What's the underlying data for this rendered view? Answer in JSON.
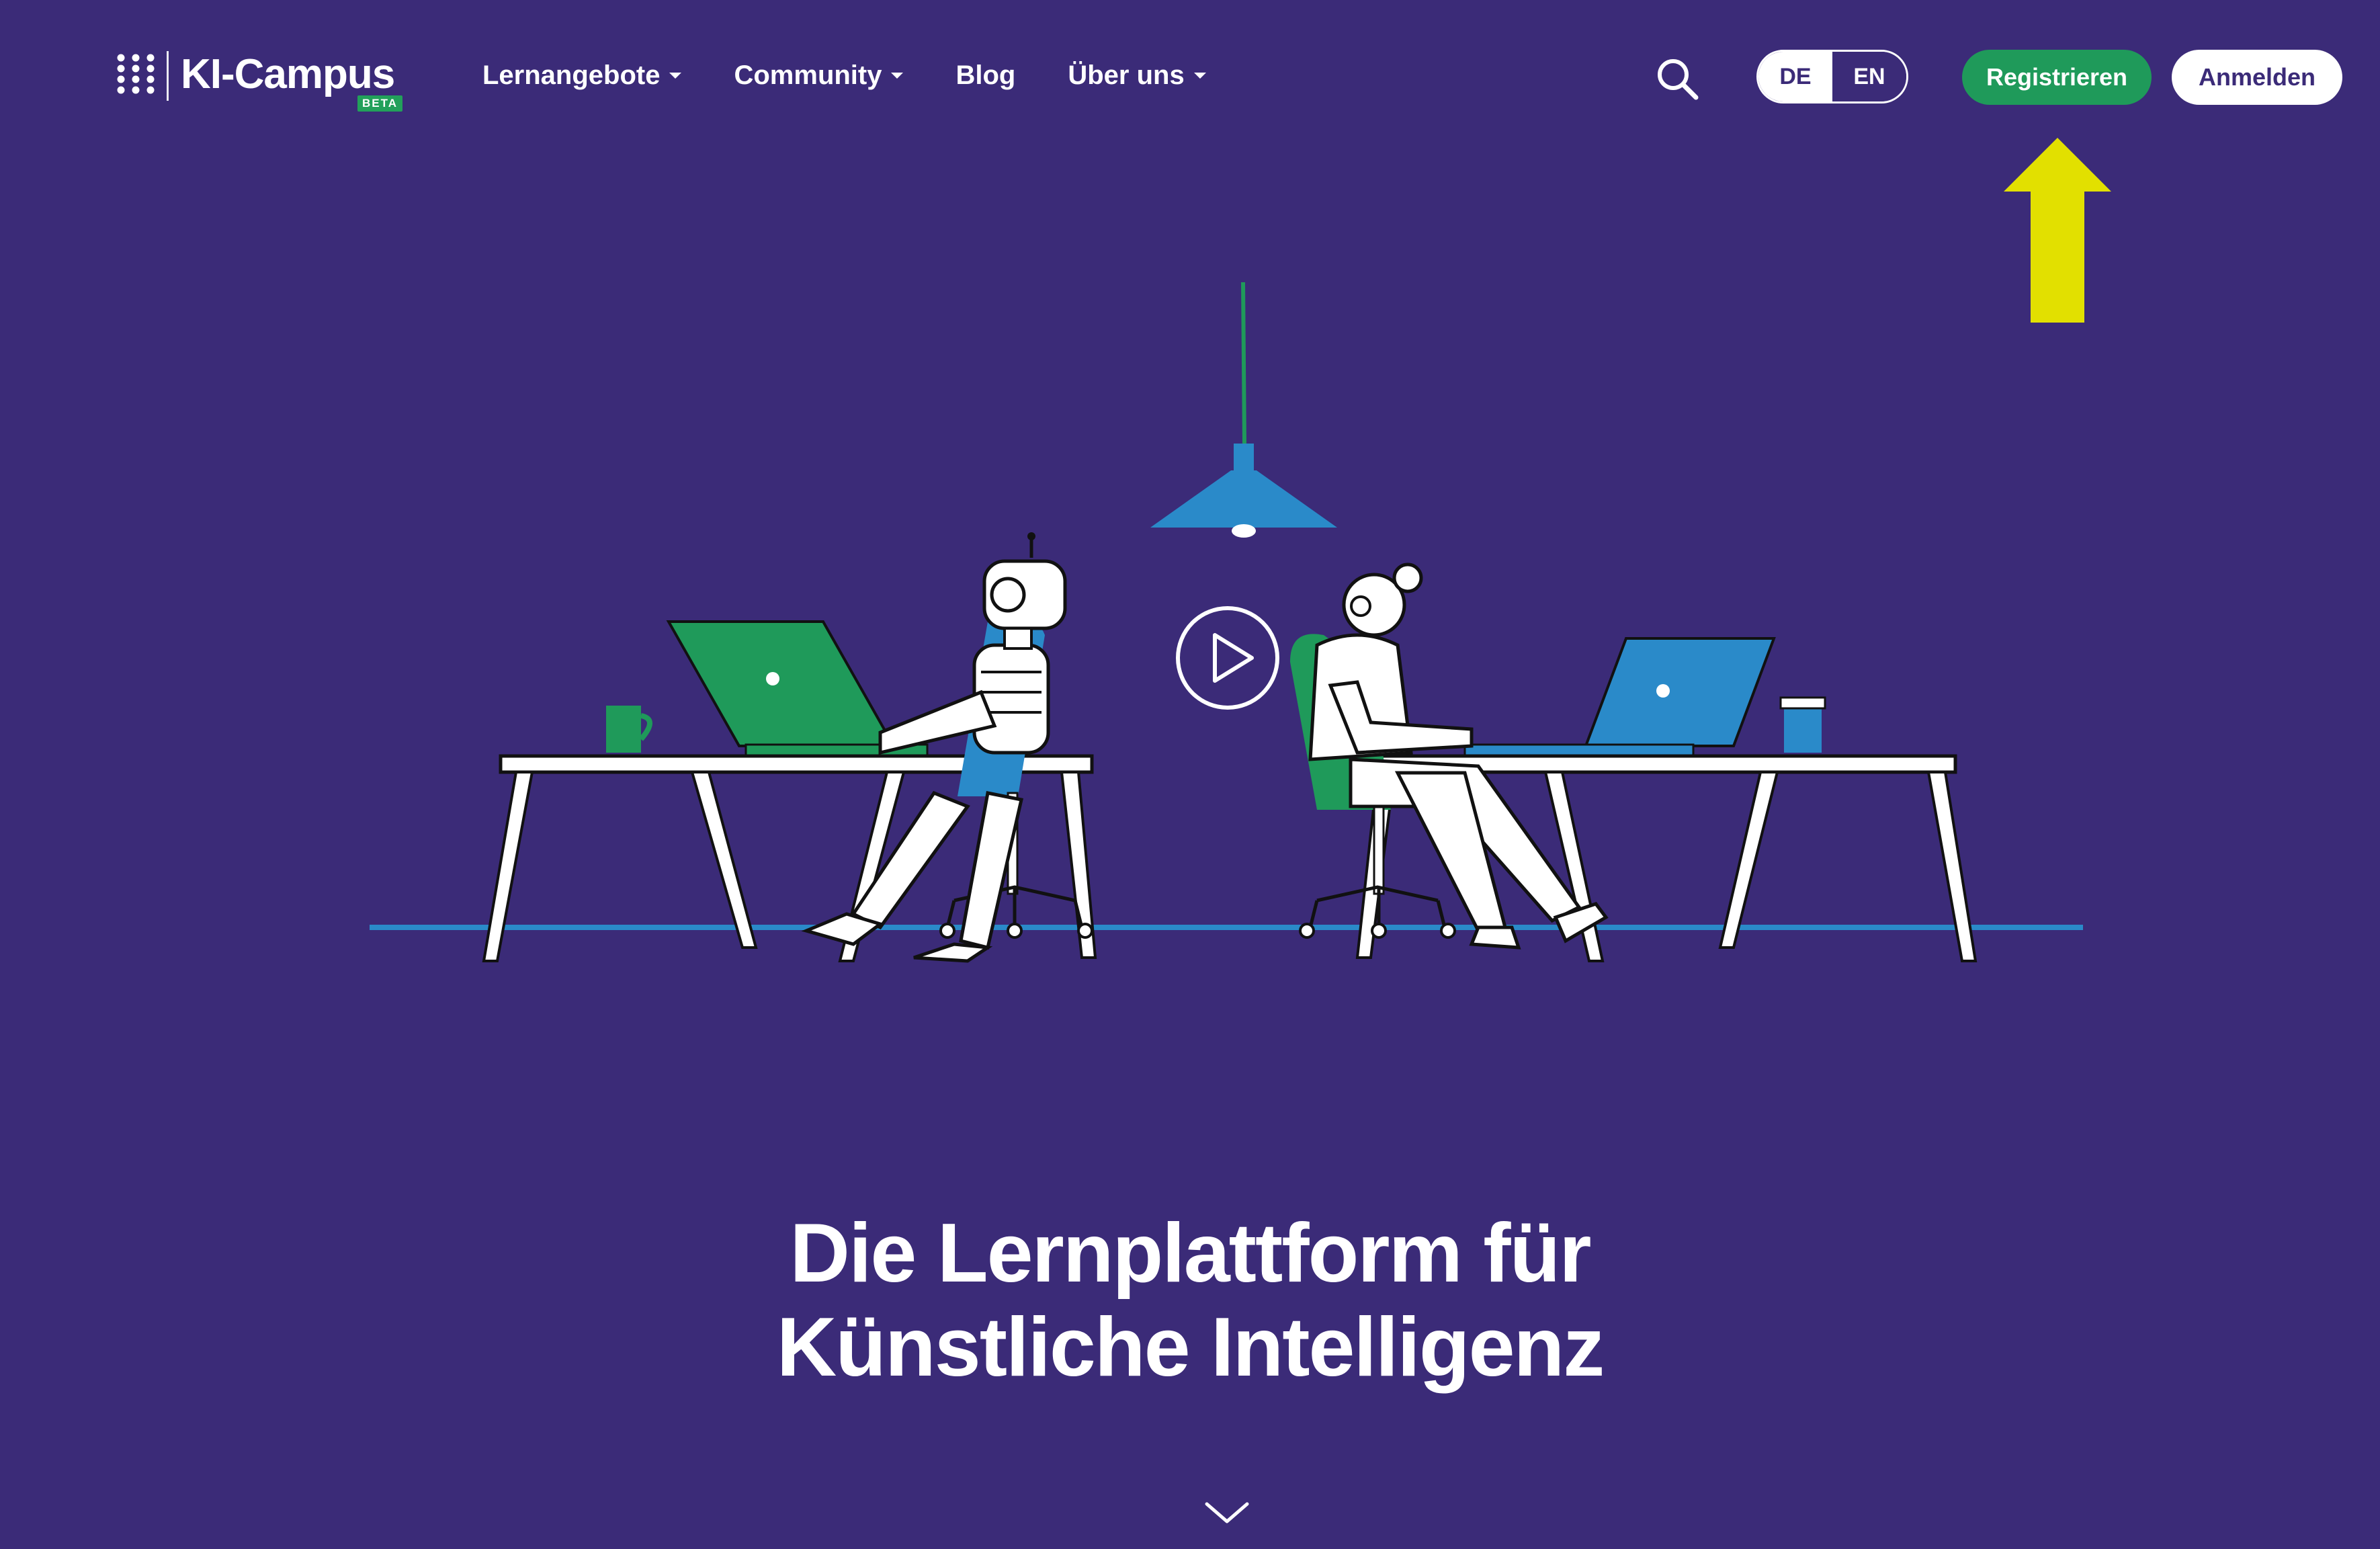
{
  "header": {
    "brand": "KI-Campus",
    "beta_badge": "BETA",
    "nav": [
      {
        "label": "Lernangebote",
        "has_dropdown": true
      },
      {
        "label": "Community",
        "has_dropdown": true
      },
      {
        "label": "Blog",
        "has_dropdown": false
      },
      {
        "label": "Über uns",
        "has_dropdown": true
      }
    ],
    "search_icon": "search-icon",
    "language": {
      "de": "DE",
      "en": "EN",
      "active": "DE"
    },
    "register_label": "Registrieren",
    "login_label": "Anmelden"
  },
  "hero": {
    "title_line1": "Die Lernplattform für",
    "title_line2": "Künstliche Intelligenz",
    "play_icon": "play-icon",
    "scroll_icon": "chevron-down-icon"
  },
  "annotation": {
    "arrow_color": "#e2e000",
    "target": "register-button"
  },
  "colors": {
    "background": "#3b2b78",
    "accent_green": "#1f9a5a",
    "accent_blue": "#2a8ac9",
    "white": "#ffffff"
  }
}
